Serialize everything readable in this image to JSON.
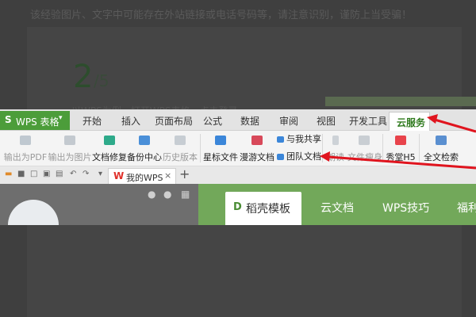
{
  "background": {
    "notice": "该经验图片、文字中可能存在外站链接或电话号码等，请注意识别，谨防上当受骗！",
    "step_number": "2",
    "step_total": "/5",
    "caption": "以WPS为例，打开WPS表格，点击登录"
  },
  "app": {
    "badge_mark": "S",
    "name": "WPS 表格",
    "dropdown": "▾"
  },
  "ribbon_tabs": [
    "开始",
    "插入",
    "页面布局",
    "公式",
    "数据",
    "审阅",
    "视图",
    "开发工具",
    "云服务"
  ],
  "active_tab": "云服务",
  "toolbar": {
    "export_pdf": "输出为PDF",
    "export_image": "输出为图片",
    "doc_repair": "文档修复",
    "backup_center": "备份中心",
    "history_version": "历史版本",
    "starred_files": "星标文件",
    "roaming_docs": "漫游文档",
    "shared_with_me": "与我共享",
    "team_docs": "团队文档",
    "read_aloud": "朗读",
    "doc_slim": "文件瘦身",
    "show_h5": "秀堂H5",
    "full_text_search": "全文检索"
  },
  "doc_tabs": {
    "current_tab": "我的WPS",
    "close_glyph": "×",
    "new_tab_glyph": "+"
  },
  "home": {
    "docer_tab": "稻壳模板",
    "nav": [
      "云文档",
      "WPS技巧",
      "福利"
    ]
  },
  "colors": {
    "brand_green": "#4c9d3a",
    "header_green": "#72a85a",
    "annotation_red": "#e0141e"
  }
}
